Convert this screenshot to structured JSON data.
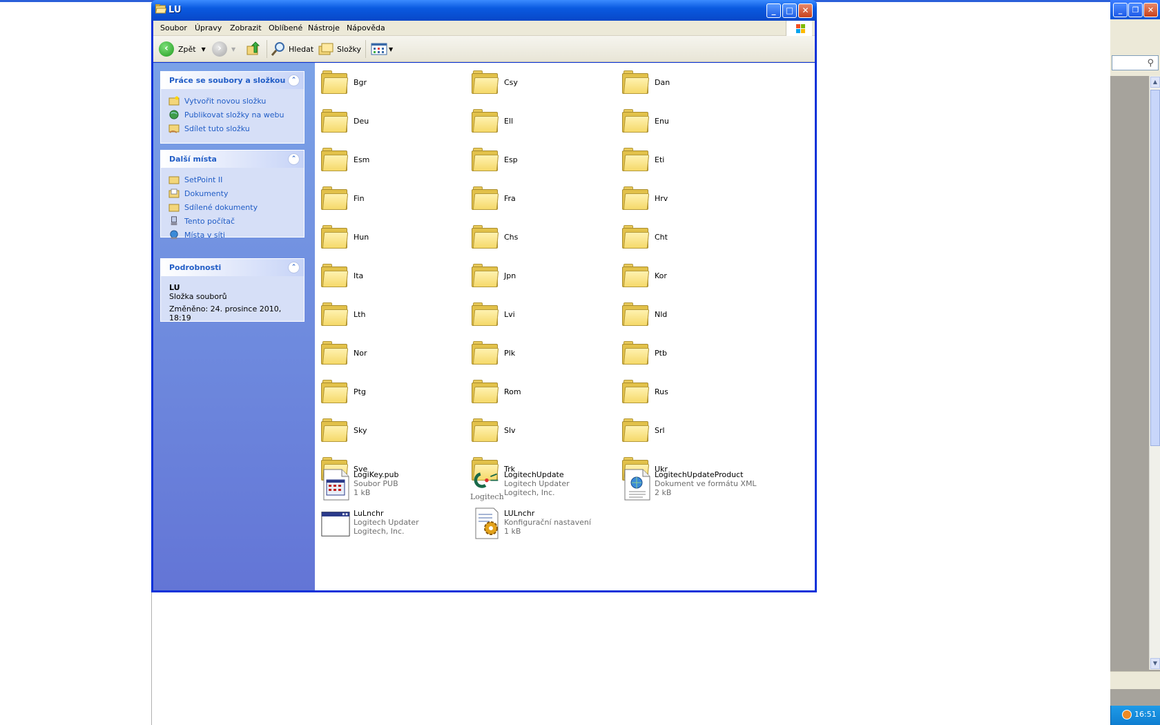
{
  "window": {
    "title": "LU",
    "min_label": "_",
    "max_label": "□",
    "close_label": "✕"
  },
  "menu": [
    "Soubor",
    "Úpravy",
    "Zobrazit",
    "Oblíbené",
    "Nástroje",
    "Nápověda"
  ],
  "toolbar": {
    "back_label": "Zpět",
    "search_label": "Hledat",
    "folders_label": "Složky"
  },
  "sidebar": {
    "tasks_panel": {
      "title": "Práce se soubory a složkou",
      "items": [
        {
          "label": "Vytvořit novou složku",
          "icon": "new-folder-icon"
        },
        {
          "label": "Publikovat složky na webu",
          "icon": "publish-web-icon"
        },
        {
          "label": "Sdílet tuto složku",
          "icon": "share-folder-icon"
        }
      ]
    },
    "places_panel": {
      "title": "Další místa",
      "items": [
        {
          "label": "SetPoint II",
          "icon": "folder-icon"
        },
        {
          "label": "Dokumenty",
          "icon": "documents-icon"
        },
        {
          "label": "Sdílené dokumenty",
          "icon": "shared-documents-icon"
        },
        {
          "label": "Tento počítač",
          "icon": "computer-icon"
        },
        {
          "label": "Místa v síti",
          "icon": "network-icon"
        }
      ]
    },
    "details_panel": {
      "title": "Podrobnosti",
      "name": "LU",
      "type": "Složka souborů",
      "modified": "Změněno: 24. prosince 2010, 18:19"
    }
  },
  "folders": [
    "Bgr",
    "Csy",
    "Dan",
    "Deu",
    "Ell",
    "Enu",
    "Esm",
    "Esp",
    "Eti",
    "Fin",
    "Fra",
    "Hrv",
    "Hun",
    "Chs",
    "Cht",
    "Ita",
    "Jpn",
    "Kor",
    "Lth",
    "Lvi",
    "Nld",
    "Nor",
    "Plk",
    "Ptb",
    "Ptg",
    "Rom",
    "Rus",
    "Sky",
    "Slv",
    "Srl",
    "Sve",
    "Trk",
    "Ukr"
  ],
  "files": [
    {
      "name": "LogiKey.pub",
      "line1": "Soubor PUB",
      "line2": "1 kB",
      "icon": "pub-file-icon"
    },
    {
      "name": "LogitechUpdate",
      "line1": "Logitech Updater",
      "line2": "Logitech, Inc.",
      "icon": "logitech-app-icon",
      "logo_text": "Logitech"
    },
    {
      "name": "LogitechUpdateProduct",
      "line1": "Dokument ve formátu XML",
      "line2": "2 kB",
      "icon": "xml-file-icon"
    },
    {
      "name": "LuLnchr",
      "line1": "Logitech Updater",
      "line2": "Logitech, Inc.",
      "icon": "app-window-icon"
    },
    {
      "name": "LULnchr",
      "line1": "Konfigurační nastavení",
      "line2": "1 kB",
      "icon": "config-file-icon"
    }
  ],
  "taskbar": {
    "clock": "16:51"
  },
  "colors": {
    "title_blue": "#0a5ae0",
    "link_blue": "#215dc6",
    "sidebar_blue": "#7ba2e7"
  }
}
